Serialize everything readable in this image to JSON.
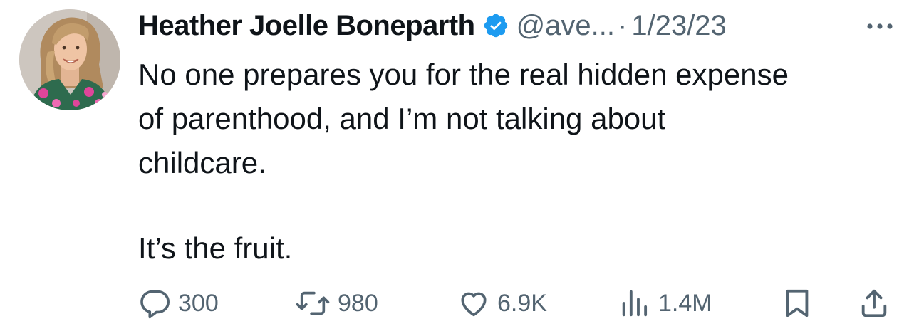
{
  "tweet": {
    "display_name": "Heather Joelle Boneparth",
    "handle": "@ave...",
    "separator": "·",
    "date": "1/23/23",
    "text_lines": [
      "No one prepares you for the real hidden expense",
      "of parenthood, and I’m not talking about",
      "childcare."
    ],
    "text_line_2": "It’s the fruit.",
    "icons": {
      "verified": "verified-badge-icon",
      "more": "more-icon"
    }
  },
  "actions": {
    "reply": {
      "icon": "reply-icon",
      "count": "300"
    },
    "retweet": {
      "icon": "retweet-icon",
      "count": "980"
    },
    "like": {
      "icon": "heart-icon",
      "count": "6.9K"
    },
    "views": {
      "icon": "views-icon",
      "count": "1.4M"
    },
    "bookmark": {
      "icon": "bookmark-icon"
    },
    "share": {
      "icon": "share-icon"
    }
  },
  "colors": {
    "text": "#0f1419",
    "secondary": "#536471",
    "verified": "#1d9bf0",
    "background": "#ffffff"
  }
}
